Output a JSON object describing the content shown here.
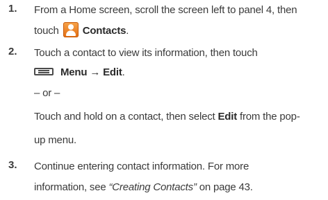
{
  "steps": [
    {
      "number": "1.",
      "line1": "From a Home screen, scroll the screen left to panel 4, then",
      "line2_prefix": "touch",
      "line2_bold": "Contacts",
      "line2_suffix": "."
    },
    {
      "number": "2.",
      "line1": "Touch a contact to view its information, then touch",
      "menu_bold": "Menu → Edit",
      "menu_suffix": ".",
      "or": "– or –",
      "alt_prefix": "Touch and hold on a contact, then select ",
      "alt_bold": "Edit",
      "alt_suffix": " from the pop-",
      "alt_line2": "up menu."
    },
    {
      "number": "3.",
      "line1": "Continue entering contact information. For more",
      "line2_prefix": "information, see ",
      "line2_italic": "“Creating Contacts”",
      "line2_suffix": " on page 43."
    }
  ],
  "icons": {
    "contacts": "contacts-icon",
    "menu": "menu-icon"
  }
}
